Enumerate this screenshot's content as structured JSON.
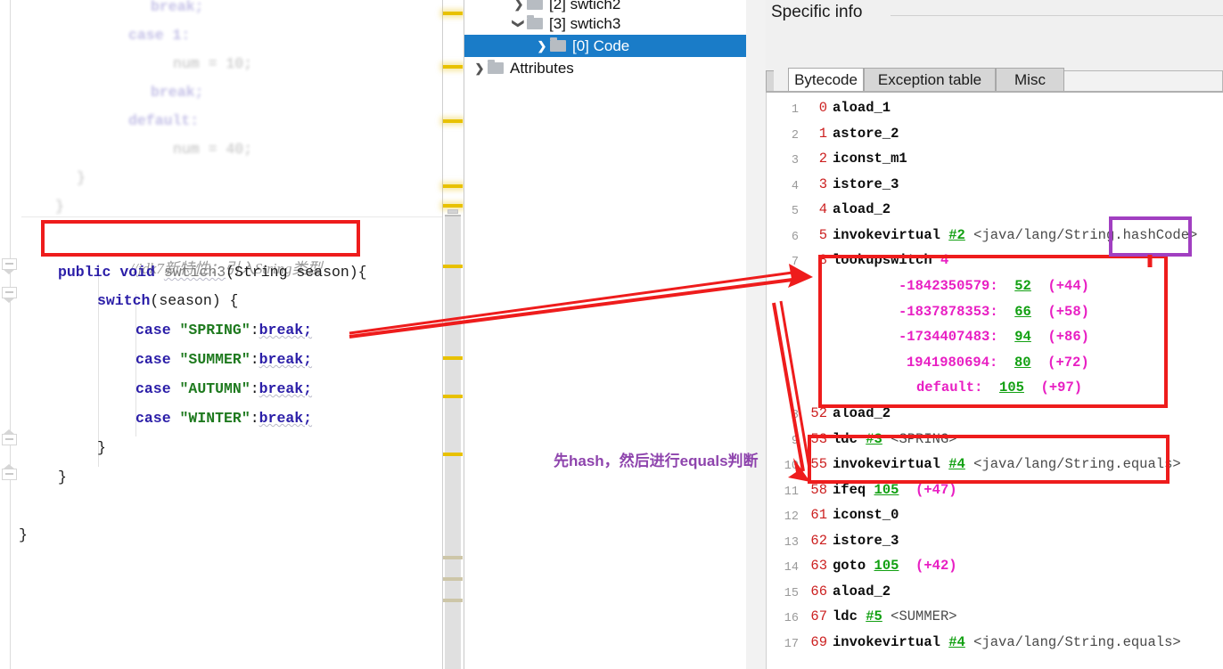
{
  "colors": {
    "selection_blue": "#1a7cc8",
    "annotation_red": "#ee1c1c",
    "annotation_purple": "#a13fc1",
    "annotation_text_purple": "#8e44ad",
    "offset_red": "#cc2020",
    "cpref_green": "#12a012",
    "magenta": "#e81fc3",
    "marker_yellow": "#e8c100",
    "string_green": "#1f7a1f",
    "keyword_blue": "#2b1ea8"
  },
  "editor": {
    "lines": [
      {
        "text": "break;",
        "kind": "faded"
      },
      {
        "text": "case 1:",
        "kind": "faded"
      },
      {
        "text": "num = 10;",
        "kind": "faded"
      },
      {
        "text": "break;",
        "kind": "faded"
      },
      {
        "text": "default:",
        "kind": "faded"
      },
      {
        "text": "num = 40;",
        "kind": "faded"
      },
      {
        "text": "}",
        "kind": "faded"
      },
      {
        "text": "}",
        "kind": "faded"
      }
    ],
    "comment": "//jdk7新特性：引入String类型",
    "signature": {
      "modifier": "public",
      "returns": "void",
      "name": "swtich3",
      "params": "(String season){"
    },
    "switch_header": "switch(season) {",
    "cases": [
      {
        "kw": "case",
        "value": "\"SPRING\"",
        "body": "break;"
      },
      {
        "kw": "case",
        "value": "\"SUMMER\"",
        "body": "break;"
      },
      {
        "kw": "case",
        "value": "\"AUTUMN\"",
        "body": "break;"
      },
      {
        "kw": "case",
        "value": "\"WINTER\"",
        "body": "break;"
      }
    ],
    "close_switch": "}",
    "close_method": "}",
    "close_class": "}"
  },
  "tree": {
    "items": [
      {
        "label": "[2] swtich2",
        "indent": 1,
        "chevron": "right",
        "selected": false
      },
      {
        "label": "[3] swtich3",
        "indent": 1,
        "chevron": "down",
        "selected": false
      },
      {
        "label": "[0] Code",
        "indent": 2,
        "chevron": "right",
        "selected": true
      },
      {
        "label": "Attributes",
        "indent": 0,
        "chevron": "right",
        "selected": false
      }
    ]
  },
  "specific_info": {
    "title": "Specific info",
    "tabs": [
      {
        "label": "Bytecode",
        "active": true
      },
      {
        "label": "Exception table",
        "active": false
      },
      {
        "label": "Misc",
        "active": false
      }
    ]
  },
  "bytecode": {
    "rows": [
      {
        "line": "1",
        "offset": "0",
        "mnemonic": "aload_1"
      },
      {
        "line": "2",
        "offset": "1",
        "mnemonic": "astore_2"
      },
      {
        "line": "3",
        "offset": "2",
        "mnemonic": "iconst_m1"
      },
      {
        "line": "4",
        "offset": "3",
        "mnemonic": "istore_3"
      },
      {
        "line": "5",
        "offset": "4",
        "mnemonic": "aload_2"
      },
      {
        "line": "6",
        "offset": "5",
        "mnemonic": "invokevirtual",
        "cpref": "#2",
        "desc": "<java/lang/String.hashCode>"
      },
      {
        "line": "7",
        "offset": "8",
        "mnemonic": "lookupswitch",
        "count": "4",
        "switch_cases": [
          {
            "key": "-1842350579:",
            "target": "52",
            "delta": "(+44)"
          },
          {
            "key": "-1837878353:",
            "target": "66",
            "delta": "(+58)"
          },
          {
            "key": "-1734407483:",
            "target": "94",
            "delta": "(+86)"
          },
          {
            "key": "1941980694:",
            "target": "80",
            "delta": "(+72)"
          },
          {
            "key": "default:",
            "target": "105",
            "delta": "(+97)"
          }
        ]
      },
      {
        "line": "8",
        "offset": "52",
        "mnemonic": "aload_2"
      },
      {
        "line": "9",
        "offset": "53",
        "mnemonic": "ldc",
        "cpref": "#3",
        "desc": "<SPRING>"
      },
      {
        "line": "10",
        "offset": "55",
        "mnemonic": "invokevirtual",
        "cpref": "#4",
        "desc": "<java/lang/String.equals>"
      },
      {
        "line": "11",
        "offset": "58",
        "mnemonic": "ifeq",
        "target": "105",
        "delta": "(+47)"
      },
      {
        "line": "12",
        "offset": "61",
        "mnemonic": "iconst_0"
      },
      {
        "line": "13",
        "offset": "62",
        "mnemonic": "istore_3"
      },
      {
        "line": "14",
        "offset": "63",
        "mnemonic": "goto",
        "target": "105",
        "delta": "(+42)"
      },
      {
        "line": "15",
        "offset": "66",
        "mnemonic": "aload_2"
      },
      {
        "line": "16",
        "offset": "67",
        "mnemonic": "ldc",
        "cpref": "#5",
        "desc": "<SUMMER>"
      },
      {
        "line": "17",
        "offset": "69",
        "mnemonic": "invokevirtual",
        "cpref": "#4",
        "desc": "<java/lang/String.equals>"
      }
    ]
  },
  "annotations": {
    "hash_note": "先hash，然后进行equals判断"
  }
}
